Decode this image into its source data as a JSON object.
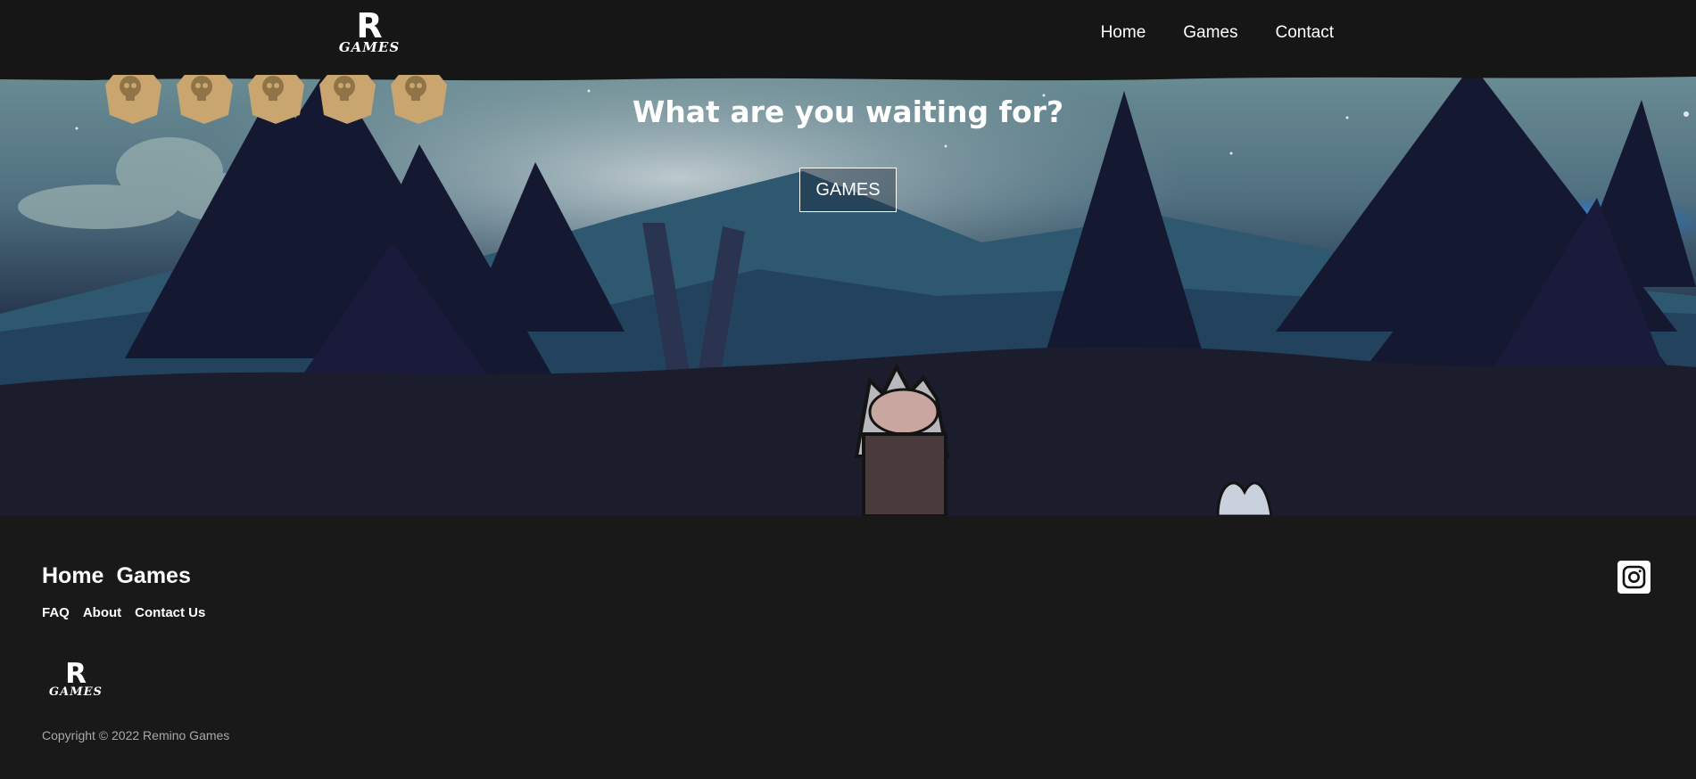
{
  "header": {
    "logo": {
      "letter": "R",
      "word": "GAMES"
    },
    "nav": [
      {
        "label": "Home"
      },
      {
        "label": "Games"
      },
      {
        "label": "Contact"
      }
    ]
  },
  "hero": {
    "title": "What are you waiting for?",
    "button_label": "GAMES",
    "skull_tokens": 5
  },
  "footer": {
    "main_links": [
      {
        "label": "Home"
      },
      {
        "label": "Games"
      }
    ],
    "sub_links": [
      {
        "label": "FAQ"
      },
      {
        "label": "About"
      },
      {
        "label": "Contact Us"
      }
    ],
    "logo": {
      "letter": "R",
      "word": "GAMES"
    },
    "copyright": "Copyright © 2022 Remino Games",
    "social_icon": "instagram-icon"
  },
  "colors": {
    "header_bg": "#161616",
    "footer_bg": "#1a1919",
    "copyright_text": "#a9a9a9",
    "skull_token": "#c9a570"
  }
}
